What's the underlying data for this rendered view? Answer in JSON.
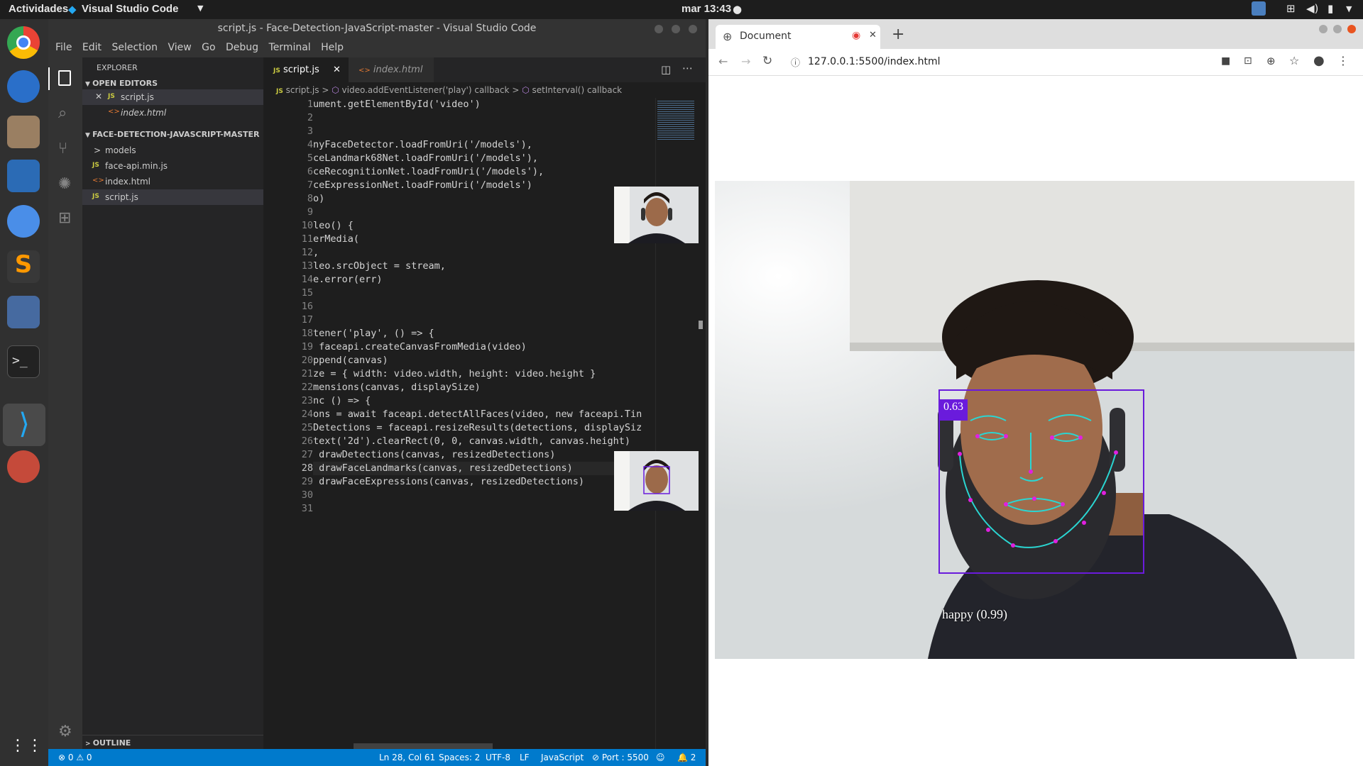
{
  "topbar": {
    "activities": "Actividades",
    "app_name": "Visual Studio Code",
    "clock": "mar 13:43"
  },
  "vscode": {
    "title": "script.js - Face-Detection-JavaScript-master - Visual Studio Code",
    "menu": [
      "File",
      "Edit",
      "Selection",
      "View",
      "Go",
      "Debug",
      "Terminal",
      "Help"
    ],
    "explorer": {
      "header": "EXPLORER",
      "open_editors_label": "OPEN EDITORS",
      "open_editors": [
        {
          "name": "script.js",
          "badge": "JS"
        },
        {
          "name": "index.html",
          "badge": "<>"
        }
      ],
      "project_label": "FACE-DETECTION-JAVASCRIPT-MASTER",
      "files": [
        {
          "name": "models",
          "badge": ">"
        },
        {
          "name": "face-api.min.js",
          "badge": "JS"
        },
        {
          "name": "index.html",
          "badge": "<>"
        },
        {
          "name": "script.js",
          "badge": "JS"
        }
      ],
      "outline_label": "OUTLINE"
    },
    "tabs": [
      {
        "label": "script.js",
        "badge": "JS"
      },
      {
        "label": "index.html",
        "badge": "<>"
      }
    ],
    "breadcrumb": {
      "file": "script.js",
      "fn1": "video.addEventListener('play') callback",
      "fn2": "setInterval() callback"
    },
    "lines": [
      "ument.getElementById('video')",
      "",
      "",
      "nyFaceDetector.loadFromUri('/models'),",
      "ceLandmark68Net.loadFromUri('/models'),",
      "ceRecognitionNet.loadFromUri('/models'),",
      "ceExpressionNet.loadFromUri('/models')",
      "o)",
      "",
      "leo() {",
      "erMedia(",
      ",",
      "leo.srcObject = stream,",
      "e.error(err)",
      "",
      "",
      "",
      "tener('play', () => {",
      " faceapi.createCanvasFromMedia(video)",
      "ppend(canvas)",
      "ze = { width: video.width, height: video.height }",
      "mensions(canvas, displaySize)",
      "nc () => {",
      "ons = await faceapi.detectAllFaces(video, new faceapi.Tin",
      "Detections = faceapi.resizeResults(detections, displaySiz",
      "text('2d').clearRect(0, 0, canvas.width, canvas.height)",
      " drawDetections(canvas, resizedDetections)",
      " drawFaceLandmarks(canvas, resizedDetections)",
      " drawFaceExpressions(canvas, resizedDetections)",
      "",
      ""
    ],
    "line_numbers": [
      "1",
      "2",
      "3",
      "4",
      "5",
      "6",
      "7",
      "8",
      "9",
      "10",
      "11",
      "12",
      "13",
      "14",
      "15",
      "16",
      "17",
      "18",
      "19",
      "20",
      "21",
      "22",
      "23",
      "24",
      "25",
      "26",
      "27",
      "28",
      "29",
      "30",
      "31"
    ],
    "status": {
      "problems": "⊗ 0 ⚠ 0",
      "position": "Ln 28, Col 61",
      "spaces": "Spaces: 2",
      "encoding": "UTF-8",
      "eol": "LF",
      "language": "JavaScript",
      "port": "⊘ Port : 5500",
      "bell": "🔔 2"
    }
  },
  "chrome": {
    "tab_title": "Document",
    "url": "127.0.0.1:5500/index.html",
    "detection_score": "0.63",
    "expression": "happy (0.99)"
  },
  "colors": {
    "vscode_blue": "#007acc",
    "detect_box": "#6a1bdc",
    "landmarks": "#2ad6d2"
  }
}
